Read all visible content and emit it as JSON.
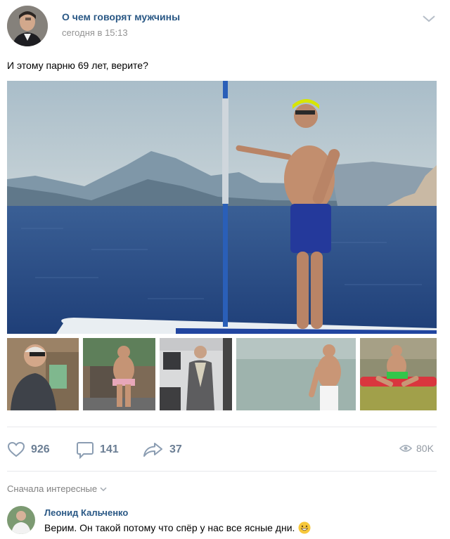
{
  "post": {
    "group_name": "О чем говорят мужчины",
    "time": "сегодня в 15:13",
    "text": "И этому парню 69 лет, верите?"
  },
  "stats": {
    "likes": "926",
    "comments": "141",
    "shares": "37",
    "views": "80K"
  },
  "comments_section": {
    "sort_label": "Сначала интересные",
    "items": [
      {
        "author": "Леонид Кальченко",
        "text": "Верим. Он такой потому что спёр у нас все ясные дни."
      }
    ]
  },
  "icons": {
    "like": "heart-icon",
    "comment": "comment-icon",
    "share": "share-icon",
    "views": "eye-icon",
    "menu": "chevron-down-icon",
    "emoji": "grinning-emoji-icon"
  },
  "colors": {
    "link_blue": "#2a5885",
    "action_gray": "#6b7e94",
    "meta_gray": "#939393",
    "divider": "#e7e8ec",
    "sea": "#2d4e85",
    "sky": "#b9cad4"
  }
}
